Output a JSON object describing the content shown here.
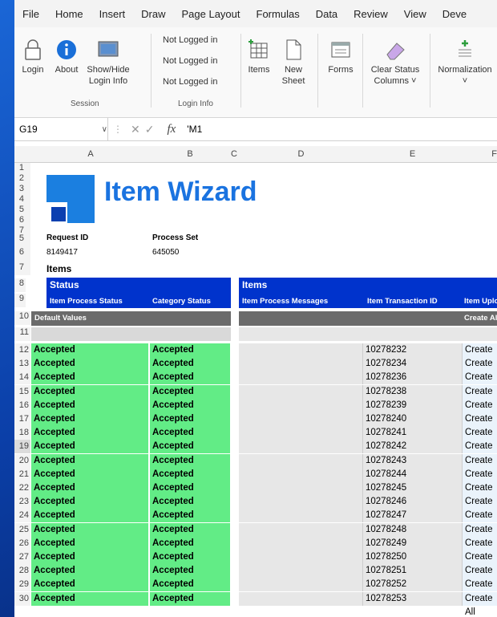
{
  "menu": [
    "File",
    "Home",
    "Insert",
    "Draw",
    "Page Layout",
    "Formulas",
    "Data",
    "Review",
    "View",
    "Deve"
  ],
  "ribbon": {
    "login": "Login",
    "about": "About",
    "showhide": "Show/Hide",
    "showhide2": "Login Info",
    "session_label": "Session",
    "status": [
      "Not Logged in",
      "Not Logged in",
      "Not Logged in"
    ],
    "logininfo_label": "Login Info",
    "items": "Items",
    "newsheet": "New",
    "newsheet2": "Sheet",
    "forms": "Forms",
    "clear1": "Clear Status",
    "clear2": "Columns ˅",
    "normalization": "Normalization",
    "norm_dropdown": "˅"
  },
  "formula": {
    "namebox": "G19",
    "value": "'M1"
  },
  "columns": [
    "A",
    "B",
    "C",
    "D",
    "E",
    "F"
  ],
  "sheet": {
    "title": "Item Wizard",
    "request_id_label": "Request ID",
    "process_set_label": "Process Set",
    "request_id": "8149417",
    "process_set": "645050",
    "items_label": "Items",
    "status_header": "Status",
    "items_header": "Items",
    "col_item_process_status": "Item Process Status",
    "col_category_status": "Category Status",
    "col_item_process_messages": "Item Process Messages",
    "col_item_transaction_id": "Item Transaction ID",
    "col_item_upload": "Item Uploa",
    "default_values": "Default Values",
    "create_all_header": "Create All"
  },
  "rows": [
    {
      "n": "12",
      "a": "Accepted",
      "b": "Accepted",
      "e": "10278232",
      "f": "Create All"
    },
    {
      "n": "13",
      "a": "Accepted",
      "b": "Accepted",
      "e": "10278234",
      "f": "Create All"
    },
    {
      "n": "14",
      "a": "Accepted",
      "b": "Accepted",
      "e": "10278236",
      "f": "Create All"
    },
    {
      "n": "15",
      "a": "Accepted",
      "b": "Accepted",
      "e": "10278238",
      "f": "Create All"
    },
    {
      "n": "16",
      "a": "Accepted",
      "b": "Accepted",
      "e": "10278239",
      "f": "Create All"
    },
    {
      "n": "17",
      "a": "Accepted",
      "b": "Accepted",
      "e": "10278240",
      "f": "Create All"
    },
    {
      "n": "18",
      "a": "Accepted",
      "b": "Accepted",
      "e": "10278241",
      "f": "Create All"
    },
    {
      "n": "19",
      "a": "Accepted",
      "b": "Accepted",
      "e": "10278242",
      "f": "Create All"
    },
    {
      "n": "20",
      "a": "Accepted",
      "b": "Accepted",
      "e": "10278243",
      "f": "Create All"
    },
    {
      "n": "21",
      "a": "Accepted",
      "b": "Accepted",
      "e": "10278244",
      "f": "Create All"
    },
    {
      "n": "22",
      "a": "Accepted",
      "b": "Accepted",
      "e": "10278245",
      "f": "Create All"
    },
    {
      "n": "23",
      "a": "Accepted",
      "b": "Accepted",
      "e": "10278246",
      "f": "Create All"
    },
    {
      "n": "24",
      "a": "Accepted",
      "b": "Accepted",
      "e": "10278247",
      "f": "Create All"
    },
    {
      "n": "25",
      "a": "Accepted",
      "b": "Accepted",
      "e": "10278248",
      "f": "Create All"
    },
    {
      "n": "26",
      "a": "Accepted",
      "b": "Accepted",
      "e": "10278249",
      "f": "Create All"
    },
    {
      "n": "27",
      "a": "Accepted",
      "b": "Accepted",
      "e": "10278250",
      "f": "Create All"
    },
    {
      "n": "28",
      "a": "Accepted",
      "b": "Accepted",
      "e": "10278251",
      "f": "Create All"
    },
    {
      "n": "29",
      "a": "Accepted",
      "b": "Accepted",
      "e": "10278252",
      "f": "Create All"
    },
    {
      "n": "30",
      "a": "Accepted",
      "b": "Accepted",
      "e": "10278253",
      "f": "Create All"
    }
  ],
  "colors": {
    "header_blue": "#0033cc",
    "accepted_green": "#62ec86",
    "logo_blue": "#1b7fe0",
    "title_blue": "#1a73e0"
  }
}
